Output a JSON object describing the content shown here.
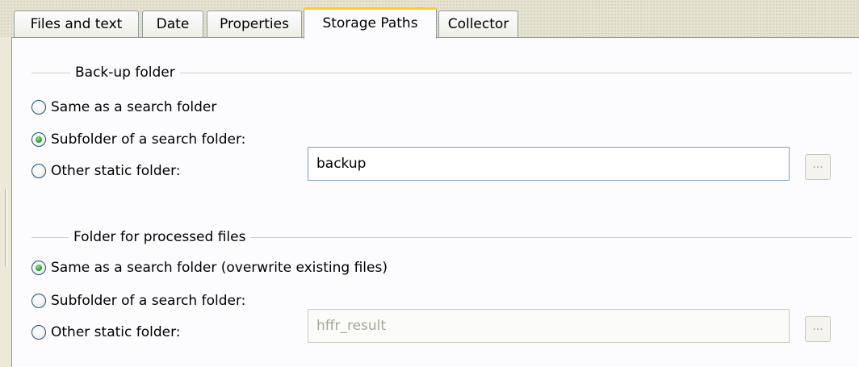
{
  "tabs": [
    {
      "label": "Files and text",
      "active": false
    },
    {
      "label": "Date",
      "active": false
    },
    {
      "label": "Properties",
      "active": false
    },
    {
      "label": "Storage Paths",
      "active": true
    },
    {
      "label": "Collector",
      "active": false
    }
  ],
  "backup_group": {
    "title": "Back-up folder",
    "options": [
      {
        "label": "Same as a search folder",
        "selected": false
      },
      {
        "label": "Subfolder of a search folder:",
        "selected": true
      },
      {
        "label": "Other static folder:",
        "selected": false
      }
    ],
    "folder_value": "backup",
    "browse_label": "..."
  },
  "processed_group": {
    "title": "Folder for processed files",
    "options": [
      {
        "label": "Same as a search folder (overwrite existing files)",
        "selected": true
      },
      {
        "label": "Subfolder of a search folder:",
        "selected": false
      },
      {
        "label": "Other static folder:",
        "selected": false
      }
    ],
    "folder_value": "hffr_result",
    "browse_label": "..."
  }
}
